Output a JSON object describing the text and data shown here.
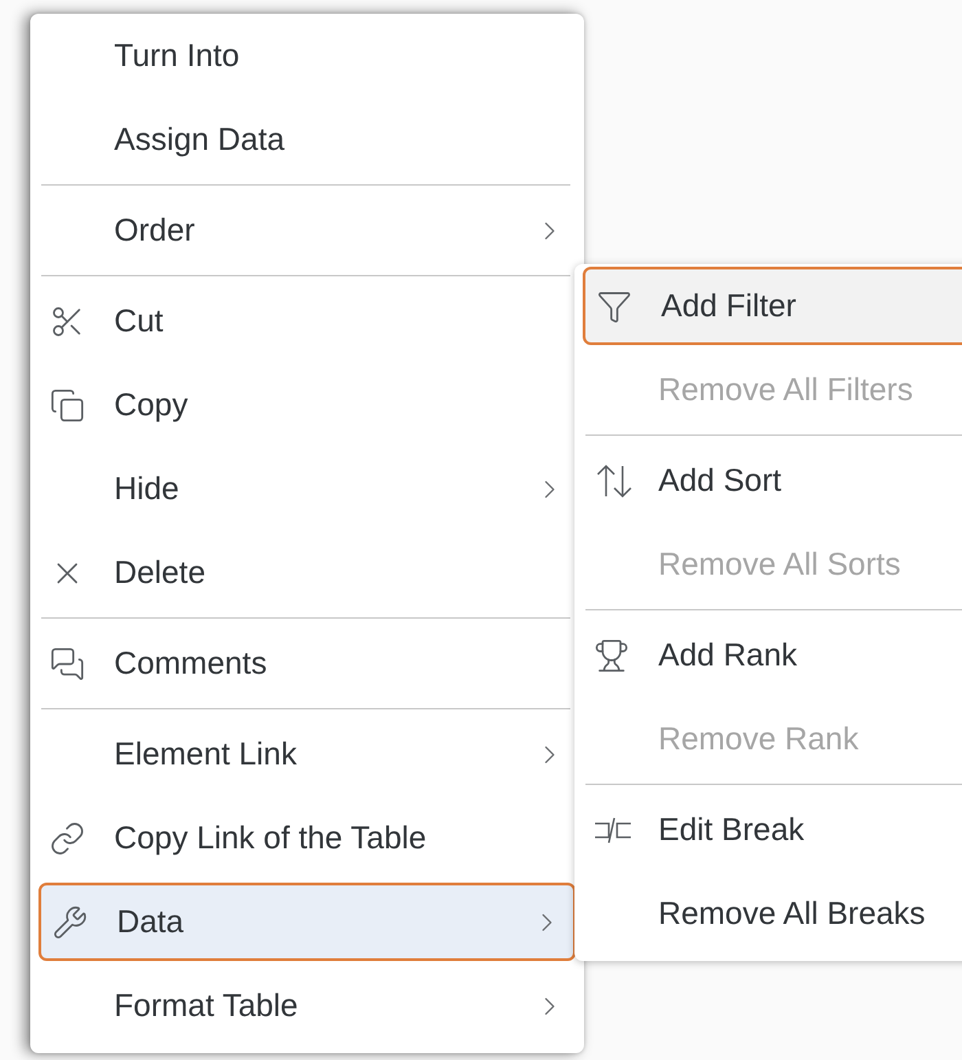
{
  "menu": {
    "items": [
      {
        "kind": "item",
        "label": "Turn Into",
        "has_submenu": false,
        "selected": false
      },
      {
        "kind": "item",
        "label": "Assign Data",
        "has_submenu": false,
        "selected": false
      },
      {
        "kind": "separator"
      },
      {
        "kind": "item",
        "label": "Order",
        "has_submenu": true,
        "selected": false
      },
      {
        "kind": "separator"
      },
      {
        "kind": "item",
        "label": "Cut",
        "has_submenu": false,
        "selected": false
      },
      {
        "kind": "item",
        "label": "Copy",
        "has_submenu": false,
        "selected": false
      },
      {
        "kind": "item",
        "label": "Hide",
        "has_submenu": true,
        "selected": false
      },
      {
        "kind": "item",
        "label": "Delete",
        "has_submenu": false,
        "selected": false
      },
      {
        "kind": "separator"
      },
      {
        "kind": "item",
        "label": "Comments",
        "has_submenu": false,
        "selected": false
      },
      {
        "kind": "separator"
      },
      {
        "kind": "item",
        "label": "Element Link",
        "has_submenu": true,
        "selected": false
      },
      {
        "kind": "item",
        "label": "Copy Link of the Table",
        "has_submenu": false,
        "selected": false
      },
      {
        "kind": "item",
        "label": "Data",
        "has_submenu": true,
        "selected": true
      },
      {
        "kind": "item",
        "label": "Format Table",
        "has_submenu": true,
        "selected": false
      }
    ]
  },
  "submenu": {
    "items": [
      {
        "kind": "item",
        "label": "Add Filter",
        "disabled": false,
        "selected": true
      },
      {
        "kind": "item",
        "label": "Remove All Filters",
        "disabled": true,
        "selected": false
      },
      {
        "kind": "separator"
      },
      {
        "kind": "item",
        "label": "Add Sort",
        "disabled": false,
        "selected": false
      },
      {
        "kind": "item",
        "label": "Remove All Sorts",
        "disabled": true,
        "selected": false
      },
      {
        "kind": "separator"
      },
      {
        "kind": "item",
        "label": "Add Rank",
        "disabled": false,
        "selected": false
      },
      {
        "kind": "item",
        "label": "Remove Rank",
        "disabled": true,
        "selected": false
      },
      {
        "kind": "separator"
      },
      {
        "kind": "item",
        "label": "Edit Break",
        "disabled": false,
        "selected": false
      },
      {
        "kind": "item",
        "label": "Remove All Breaks",
        "disabled": false,
        "selected": false
      }
    ]
  }
}
